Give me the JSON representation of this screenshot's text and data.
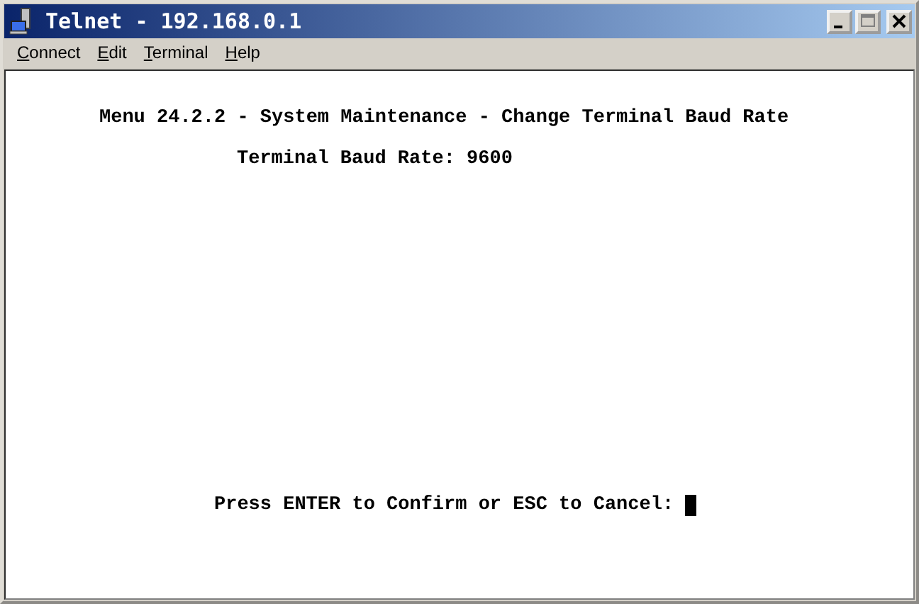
{
  "window": {
    "title": "Telnet - 192.168.0.1"
  },
  "menu": [
    {
      "label": "Connect"
    },
    {
      "label": "Edit"
    },
    {
      "label": "Terminal"
    },
    {
      "label": "Help"
    }
  ],
  "terminal": {
    "heading": "Menu 24.2.2 - System Maintenance - Change Terminal Baud Rate",
    "field": "Terminal Baud Rate: 9600",
    "prompt": "Press ENTER to Confirm or ESC to Cancel:"
  }
}
